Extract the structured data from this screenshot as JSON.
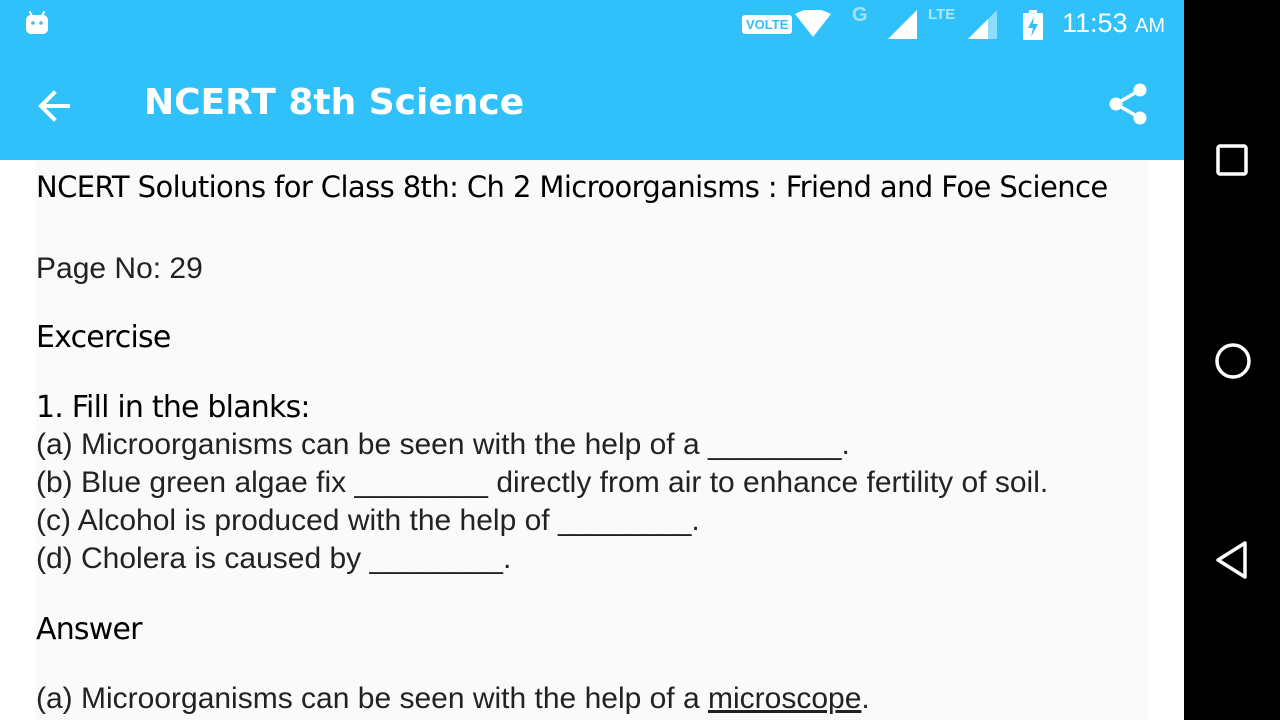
{
  "status_bar": {
    "volte": "VOLTE",
    "network_g": "G",
    "network_lte": "LTE",
    "time": "11:53",
    "ampm": "AM"
  },
  "app_bar": {
    "title": "NCERT 8th Science",
    "back_icon": "arrow-back-icon",
    "share_icon": "share-icon"
  },
  "article": {
    "title": "NCERT Solutions for Class 8th: Ch 2 Microorganisms : Friend and Foe Science",
    "page_no": "Page No: 29",
    "exercise_heading": "Excercise",
    "question_heading": "1. Fill in the blanks:",
    "questions": [
      "(a) Microorganisms can be seen with the help of a ________.",
      "(b) Blue green algae fix ________ directly from air to enhance fertility of soil.",
      "(c) Alcohol is produced with the help of ________.",
      "(d) Cholera is caused by ________."
    ],
    "answer_heading": "Answer",
    "answer_a_prefix": "(a) Microorganisms can be seen with the help of a ",
    "answer_a_value": "microscope",
    "answer_a_suffix": "."
  },
  "nav_bar": {
    "recents_icon": "square-recents-icon",
    "home_icon": "circle-home-icon",
    "back_icon": "triangle-back-icon"
  },
  "colors": {
    "app_bar": "#30c1fb",
    "nav_bar": "#000000"
  }
}
